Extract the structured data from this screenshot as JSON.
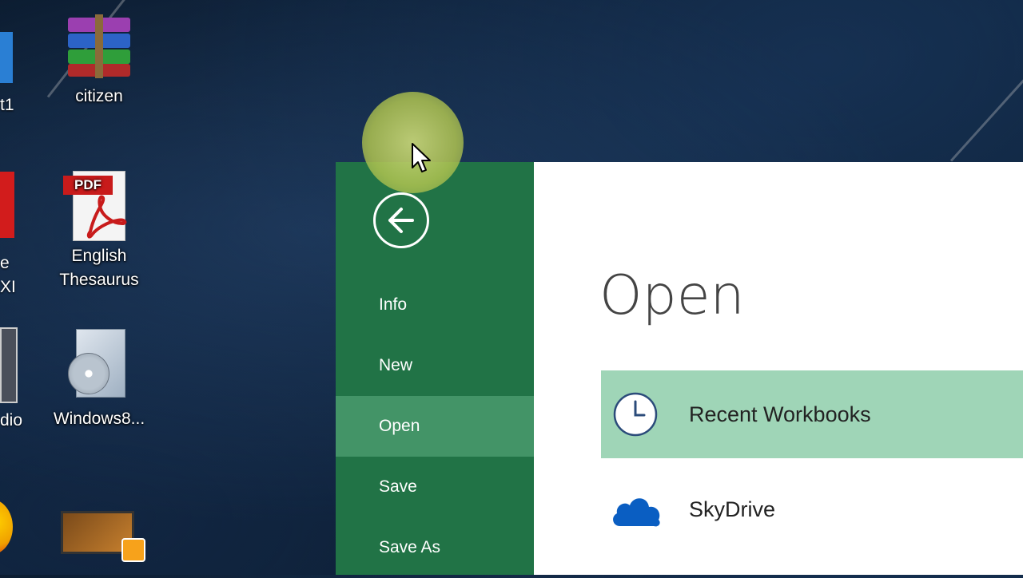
{
  "desktop": {
    "partial_labels": [
      "t1",
      "e",
      "XI",
      "dio"
    ],
    "icons": [
      {
        "label": "citizen",
        "icon": "winrar-archive-icon"
      },
      {
        "label": "English Thesaurus",
        "icon": "pdf-file-icon"
      },
      {
        "label": "Windows8...",
        "icon": "software-installer-icon"
      },
      {
        "label": "",
        "icon": "video-file-icon"
      }
    ]
  },
  "excel": {
    "back_icon": "back-arrow-icon",
    "nav": [
      {
        "label": "Info",
        "active": false
      },
      {
        "label": "New",
        "active": false
      },
      {
        "label": "Open",
        "active": true
      },
      {
        "label": "Save",
        "active": false
      },
      {
        "label": "Save As",
        "active": false
      }
    ],
    "title": "Open",
    "places": [
      {
        "label": "Recent Workbooks",
        "icon": "clock-icon",
        "selected": true
      },
      {
        "label": "SkyDrive",
        "icon": "cloud-icon",
        "selected": false
      }
    ],
    "colors": {
      "nav_bg": "#217346",
      "nav_active": "#439467",
      "place_selected": "#9fd5b7",
      "skydrive_blue": "#0a5ec2"
    }
  },
  "cursor": {
    "icon": "mouse-pointer-icon"
  }
}
